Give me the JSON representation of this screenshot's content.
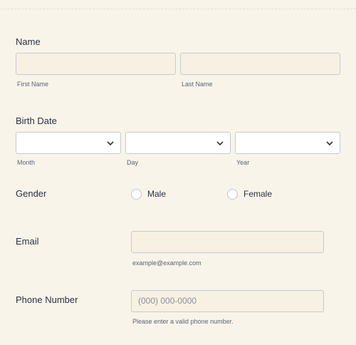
{
  "name": {
    "label": "Name",
    "first_sublabel": "First Name",
    "last_sublabel": "Last Name",
    "first_value": "",
    "last_value": ""
  },
  "birth_date": {
    "label": "Birth Date",
    "month_sublabel": "Month",
    "day_sublabel": "Day",
    "year_sublabel": "Year",
    "month_value": "",
    "day_value": "",
    "year_value": ""
  },
  "gender": {
    "label": "Gender",
    "options": [
      "Male",
      "Female"
    ]
  },
  "email": {
    "label": "Email",
    "value": "",
    "sublabel": "example@example.com"
  },
  "phone": {
    "label": "Phone Number",
    "placeholder": "(000) 000-0000",
    "sublabel": "Please enter a valid phone number."
  },
  "icons": {
    "dropdown": "chevron-down-icon",
    "radio": "radio-button-icon"
  },
  "colors": {
    "background": "#f8f4e9",
    "field_border": "#c7c9d1",
    "text": "#2b3245"
  }
}
